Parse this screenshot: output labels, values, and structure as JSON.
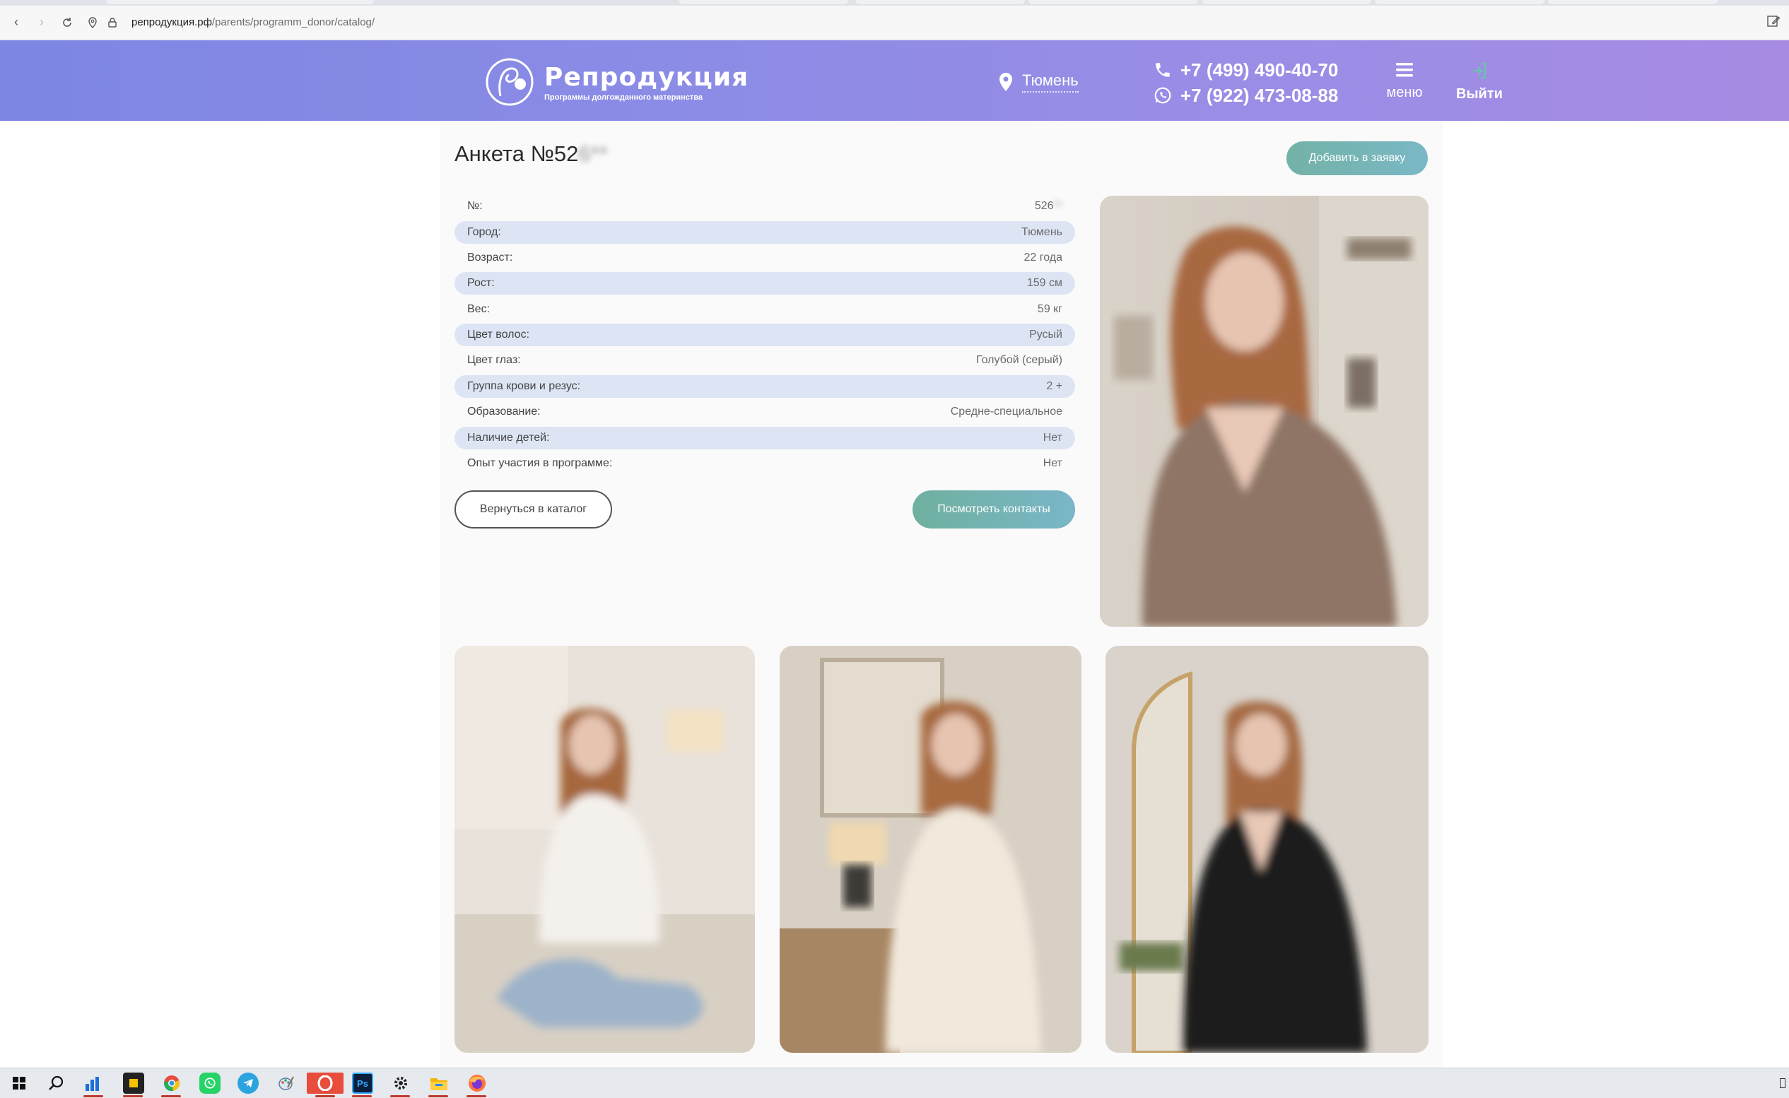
{
  "browser": {
    "url_domain": "репродукция.рф",
    "url_path": "/parents/programm_donor/catalog/"
  },
  "header": {
    "logo_title": "Репродукция",
    "logo_subtitle": "Программы долгожданного материнства",
    "city": "Тюмень",
    "phone1": "+7 (499) 490-40-70",
    "phone2": "+7 (922) 473-08-88",
    "menu_label": "меню",
    "logout_label": "Выйти"
  },
  "profile": {
    "title_prefix": "Анкета №52",
    "title_hidden": "6**",
    "add_button": "Добавить в заявку",
    "rows": [
      {
        "label": "№:",
        "value": "526",
        "hidden": "**"
      },
      {
        "label": "Город:",
        "value": "Тюмень"
      },
      {
        "label": "Возраст:",
        "value": "22 года"
      },
      {
        "label": "Рост:",
        "value": "159 см"
      },
      {
        "label": "Вес:",
        "value": "59 кг"
      },
      {
        "label": "Цвет волос:",
        "value": "Русый"
      },
      {
        "label": "Цвет глаз:",
        "value": "Голубой (серый)"
      },
      {
        "label": "Группа крови и резус:",
        "value": "2 +"
      },
      {
        "label": "Образование:",
        "value": "Средне-специальное"
      },
      {
        "label": "Наличие детей:",
        "value": "Нет"
      },
      {
        "label": "Опыт участия в программе:",
        "value": "Нет"
      }
    ],
    "back_button": "Вернуться в каталог",
    "contacts_button": "Посмотреть контакты"
  },
  "colors": {
    "header_start": "#7d86e3",
    "header_end": "#a78be3",
    "accent_teal": "#73b2a6",
    "row_alt": "#dde5f5"
  }
}
